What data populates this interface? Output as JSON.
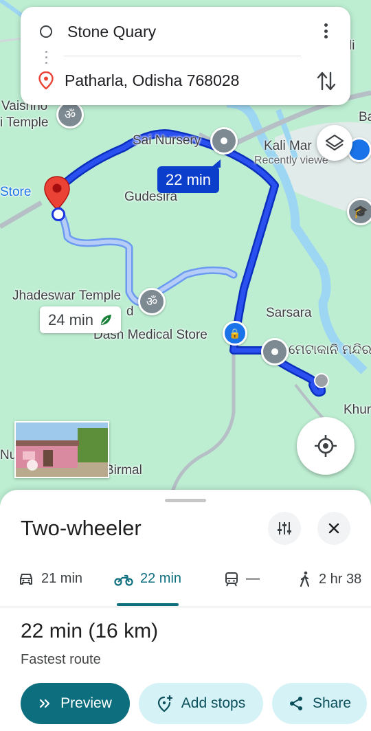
{
  "search": {
    "origin": "Stone Quary",
    "destination": "Patharla, Odisha 768028"
  },
  "map": {
    "labels": {
      "vaishno": "Vaishno",
      "temple": "i Temple",
      "store": "Store",
      "sai_nursery": "Sai Nursery",
      "kali_mar": "Kali Mar",
      "recently_viewed": "Recently viewe",
      "gudesira": "Gudesira",
      "jhadeswar": "Jhadeswar Temple",
      "dash_medical": "Dash Medical Store",
      "sarsara": "Sarsara",
      "odia_temple": "ମେଟାକାନି ମନ୍ଦିର",
      "khur": "Khur",
      "birmal": "Birmal",
      "nu": "Nu",
      "edge_li": "li",
      "edge_ba": "Ba",
      "d_letter": "d"
    },
    "route_primary_time": "22 min",
    "route_alt_time": "24 min",
    "colors": {
      "route_primary": "#1a35e0",
      "route_alt": "#a9c2f7",
      "map_bg": "#bdeed2"
    }
  },
  "sheet": {
    "mode_title": "Two-wheeler",
    "tabs": [
      {
        "icon": "car-icon",
        "label": "21 min"
      },
      {
        "icon": "motorcycle-icon",
        "label": "22 min",
        "active": true
      },
      {
        "icon": "train-icon",
        "label": "—"
      },
      {
        "icon": "walk-icon",
        "label": "2 hr 38"
      }
    ],
    "summary": "22 min (16 km)",
    "summary_sub": "Fastest route",
    "actions": {
      "preview": "Preview",
      "add_stops": "Add stops",
      "share": "Share"
    },
    "colors": {
      "primary": "#0d6e7e",
      "chip_bg": "#d5f3f7"
    }
  }
}
